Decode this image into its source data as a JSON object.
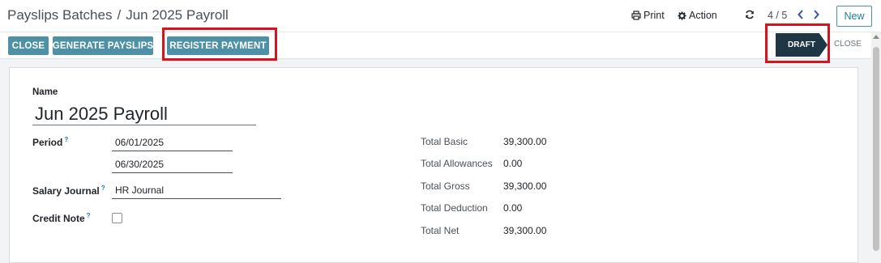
{
  "breadcrumb": {
    "parent": "Payslips Batches",
    "separator": "/",
    "current": "Jun 2025 Payroll"
  },
  "header": {
    "print_label": "Print",
    "action_label": "Action",
    "pager": "4 / 5",
    "new_label": "New"
  },
  "buttons": {
    "close": "CLOSE",
    "generate_payslips": "GENERATE PAYSLIPS",
    "register_payment": "REGISTER PAYMENT"
  },
  "statusbar": {
    "draft": "DRAFT",
    "close": "CLOSE",
    "active": "DRAFT"
  },
  "form": {
    "name_label": "Name",
    "name_value": "Jun 2025 Payroll",
    "period_label": "Period",
    "period_start": "06/01/2025",
    "period_end": "06/30/2025",
    "journal_label": "Salary Journal",
    "journal_value": "HR Journal",
    "credit_note_label": "Credit Note",
    "credit_note_checked": false,
    "help_mark": "?"
  },
  "totals": [
    {
      "label": "Total Basic",
      "value": "39,300.00"
    },
    {
      "label": "Total Allowances",
      "value": "0.00"
    },
    {
      "label": "Total Gross",
      "value": "39,300.00"
    },
    {
      "label": "Total Deduction",
      "value": "0.00"
    },
    {
      "label": "Total Net",
      "value": "39,300.00"
    }
  ],
  "colors": {
    "action_button": "#4e90a6",
    "status_active": "#1f3744",
    "highlight": "#d7141e",
    "link": "#1c7ea1"
  },
  "icons": [
    "print-icon",
    "gear-icon",
    "refresh-icon",
    "chevron-left-icon",
    "chevron-right-icon"
  ]
}
